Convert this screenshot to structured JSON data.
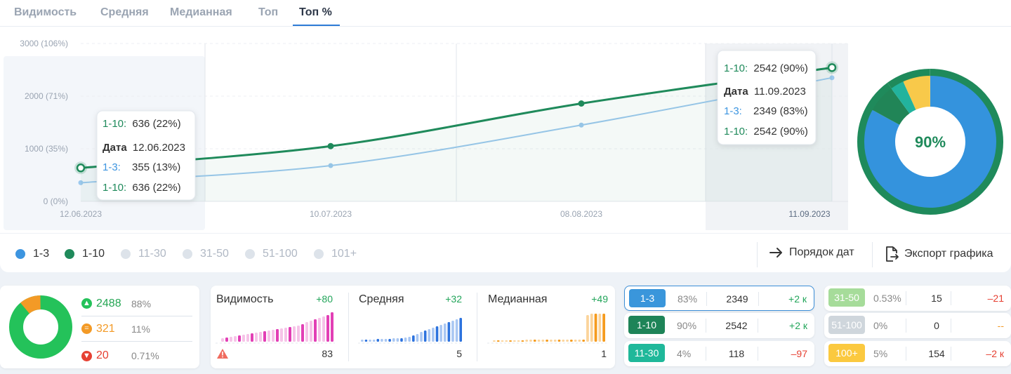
{
  "tabs": [
    "Видимость",
    "Средняя",
    "Медианная",
    "Топ",
    "Топ %"
  ],
  "chart_data": {
    "type": "line",
    "x": [
      "12.06.2023",
      "10.07.2023",
      "08.08.2023",
      "11.09.2023"
    ],
    "y_ticks": [
      "3000 (106%)",
      "2000 (71%)",
      "1000 (35%)",
      "0 (0%)"
    ],
    "ylim": [
      0,
      3000
    ],
    "series": [
      {
        "name": "1-3",
        "color": "#9cc9ee",
        "values": [
          355,
          680,
          1450,
          2349
        ]
      },
      {
        "name": "1-10",
        "color": "#1f8a5b",
        "values": [
          636,
          1050,
          1860,
          2542
        ]
      }
    ],
    "grid": true
  },
  "tooltip_left": {
    "head_label": "1-10:",
    "head_value": "636 (22%)",
    "date_label": "Дата",
    "date_value": "12.06.2023",
    "r1_label": "1-3:",
    "r1_value": "355 (13%)",
    "r2_label": "1-10:",
    "r2_value": "636 (22%)"
  },
  "tooltip_right": {
    "head_label": "1-10:",
    "head_value": "2542 (90%)",
    "date_label": "Дата",
    "date_value": "11.09.2023",
    "r1_label": "1-3:",
    "r1_value": "2349 (83%)",
    "r2_label": "1-10:",
    "r2_value": "2542 (90%)"
  },
  "donut": {
    "center_label": "90%",
    "blue_share": 0.83,
    "outer_share": 0.9
  },
  "legend": [
    {
      "label": "1-3",
      "color": "#3d95e0",
      "active": true
    },
    {
      "label": "1-10",
      "color": "#1f8a5b",
      "active": true
    },
    {
      "label": "11-30",
      "active": false
    },
    {
      "label": "31-50",
      "active": false
    },
    {
      "label": "51-100",
      "active": false
    },
    {
      "label": "101+",
      "active": false
    }
  ],
  "actions": {
    "order": "Порядок дат",
    "export": "Экспорт графика"
  },
  "summary": {
    "up": {
      "num": "2488",
      "pct": "88%"
    },
    "eq": {
      "num": "321",
      "pct": "11%"
    },
    "down": {
      "num": "20",
      "pct": "0.71%"
    }
  },
  "metrics": [
    {
      "title": "Видимость",
      "delta": "+80",
      "value": "83"
    },
    {
      "title": "Средняя",
      "delta": "+32",
      "value": "5"
    },
    {
      "title": "Медианная",
      "delta": "+49",
      "value": "1"
    }
  ],
  "ranks_left": [
    {
      "label": "1-3",
      "pct": "83%",
      "count": "2349",
      "change": "+2 к"
    },
    {
      "label": "1-10",
      "pct": "90%",
      "count": "2542",
      "change": "+2 к"
    },
    {
      "label": "11-30",
      "pct": "4%",
      "count": "118",
      "change": "–97"
    }
  ],
  "ranks_right": [
    {
      "label": "31-50",
      "pct": "0.53%",
      "count": "15",
      "change": "–21"
    },
    {
      "label": "51-100",
      "pct": "0%",
      "count": "0",
      "change": "--"
    },
    {
      "label": "100+",
      "pct": "5%",
      "count": "154",
      "change": "–2 к"
    }
  ]
}
